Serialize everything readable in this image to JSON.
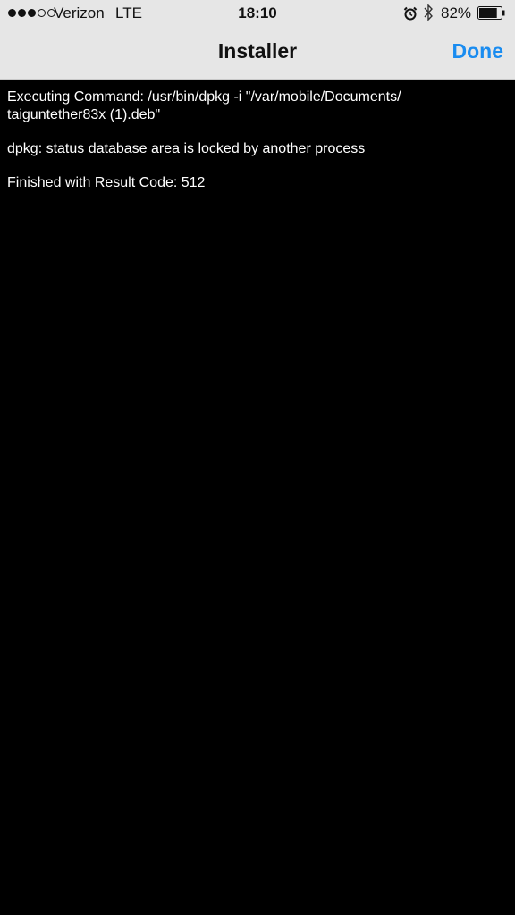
{
  "status_bar": {
    "signal_bars_filled": 3,
    "signal_bars_total": 5,
    "carrier": "Verizon",
    "network": "LTE",
    "time": "18:10",
    "battery_percent": "82%",
    "battery_level": 0.82,
    "icons": [
      "alarm-icon",
      "bluetooth-icon",
      "battery-icon"
    ]
  },
  "nav": {
    "title": "Installer",
    "done_label": "Done"
  },
  "console": {
    "lines": [
      "Executing Command: /usr/bin/dpkg -i \"/var/mobile/Documents/\ntaiguntether83x (1).deb\"",
      "dpkg: status database area is locked by another process",
      "Finished with Result Code: 512"
    ]
  },
  "colors": {
    "accent": "#1a8cf0",
    "background": "#000000",
    "nav_background": "#e6e6e6",
    "text": "#ffffff"
  }
}
